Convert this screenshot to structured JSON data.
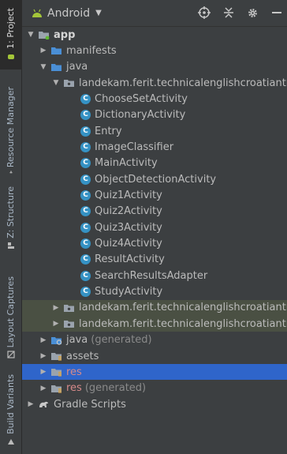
{
  "side_tabs": [
    {
      "label": "1: Project",
      "active": true,
      "icon": "android-icon"
    },
    {
      "label": "Resource Manager",
      "active": false,
      "icon": "resource-manager-icon"
    },
    {
      "label": "Z: Structure",
      "active": false,
      "icon": "structure-icon"
    },
    {
      "label": "Layout Captures",
      "active": false,
      "icon": "layout-captures-icon"
    },
    {
      "label": "Build Variants",
      "active": false,
      "icon": "build-variants-icon"
    }
  ],
  "toolbar": {
    "view_label": "Android",
    "caret": "▼"
  },
  "tree": [
    {
      "label": "app",
      "arrow": "▼",
      "indent": 0,
      "icon": "module-folder-icon",
      "style": "bold"
    },
    {
      "label": "manifests",
      "arrow": "▶",
      "indent": 1,
      "icon": "folder-icon"
    },
    {
      "label": "java",
      "arrow": "▼",
      "indent": 1,
      "icon": "folder-icon"
    },
    {
      "label": "landekam.ferit.technicalenglishcroatiantranslator",
      "arrow": "▼",
      "indent": 2,
      "icon": "package-icon"
    },
    {
      "label": "ChooseSetActivity",
      "arrow": "",
      "indent": 3,
      "icon": "class-icon"
    },
    {
      "label": "DictionaryActivity",
      "arrow": "",
      "indent": 3,
      "icon": "class-icon"
    },
    {
      "label": "Entry",
      "arrow": "",
      "indent": 3,
      "icon": "class-icon"
    },
    {
      "label": "ImageClassifier",
      "arrow": "",
      "indent": 3,
      "icon": "class-icon"
    },
    {
      "label": "MainActivity",
      "arrow": "",
      "indent": 3,
      "icon": "class-icon"
    },
    {
      "label": "ObjectDetectionActivity",
      "arrow": "",
      "indent": 3,
      "icon": "class-icon"
    },
    {
      "label": "Quiz1Activity",
      "arrow": "",
      "indent": 3,
      "icon": "class-icon"
    },
    {
      "label": "Quiz2Activity",
      "arrow": "",
      "indent": 3,
      "icon": "class-icon"
    },
    {
      "label": "Quiz3Activity",
      "arrow": "",
      "indent": 3,
      "icon": "class-icon"
    },
    {
      "label": "Quiz4Activity",
      "arrow": "",
      "indent": 3,
      "icon": "class-icon"
    },
    {
      "label": "ResultActivity",
      "arrow": "",
      "indent": 3,
      "icon": "class-icon"
    },
    {
      "label": "SearchResultsAdapter",
      "arrow": "",
      "indent": 3,
      "icon": "class-icon"
    },
    {
      "label": "StudyActivity",
      "arrow": "",
      "indent": 3,
      "icon": "class-icon"
    },
    {
      "label": "landekam.ferit.technicalenglishcroatiantranslator",
      "arrow": "▶",
      "indent": 2,
      "icon": "package-icon",
      "highlight": true
    },
    {
      "label": "landekam.ferit.technicalenglishcroatiantranslator",
      "arrow": "▶",
      "indent": 2,
      "icon": "package-icon",
      "highlight": true
    },
    {
      "label": "java (generated)",
      "arrow": "▶",
      "indent": 1,
      "icon": "generated-folder-icon",
      "style": "dim-suffix",
      "base": "java",
      "suffix": "(generated)"
    },
    {
      "label": "assets",
      "arrow": "▶",
      "indent": 1,
      "icon": "resource-folder-icon"
    },
    {
      "label": "res",
      "arrow": "▶",
      "indent": 1,
      "icon": "resource-folder-icon",
      "selected": true
    },
    {
      "label": "res (generated)",
      "arrow": "▶",
      "indent": 1,
      "icon": "resource-folder-icon",
      "style": "dim-suffix",
      "base": "res",
      "suffix": "(generated)"
    },
    {
      "label": "Gradle Scripts",
      "arrow": "▶",
      "indent": 0,
      "icon": "gradle-icon"
    }
  ],
  "colors": {
    "background": "#3c3f41",
    "selection": "#2f65ca",
    "highlight": "#4a5043",
    "class_icon": "#3592c4",
    "folder": "#4a8fd6"
  }
}
